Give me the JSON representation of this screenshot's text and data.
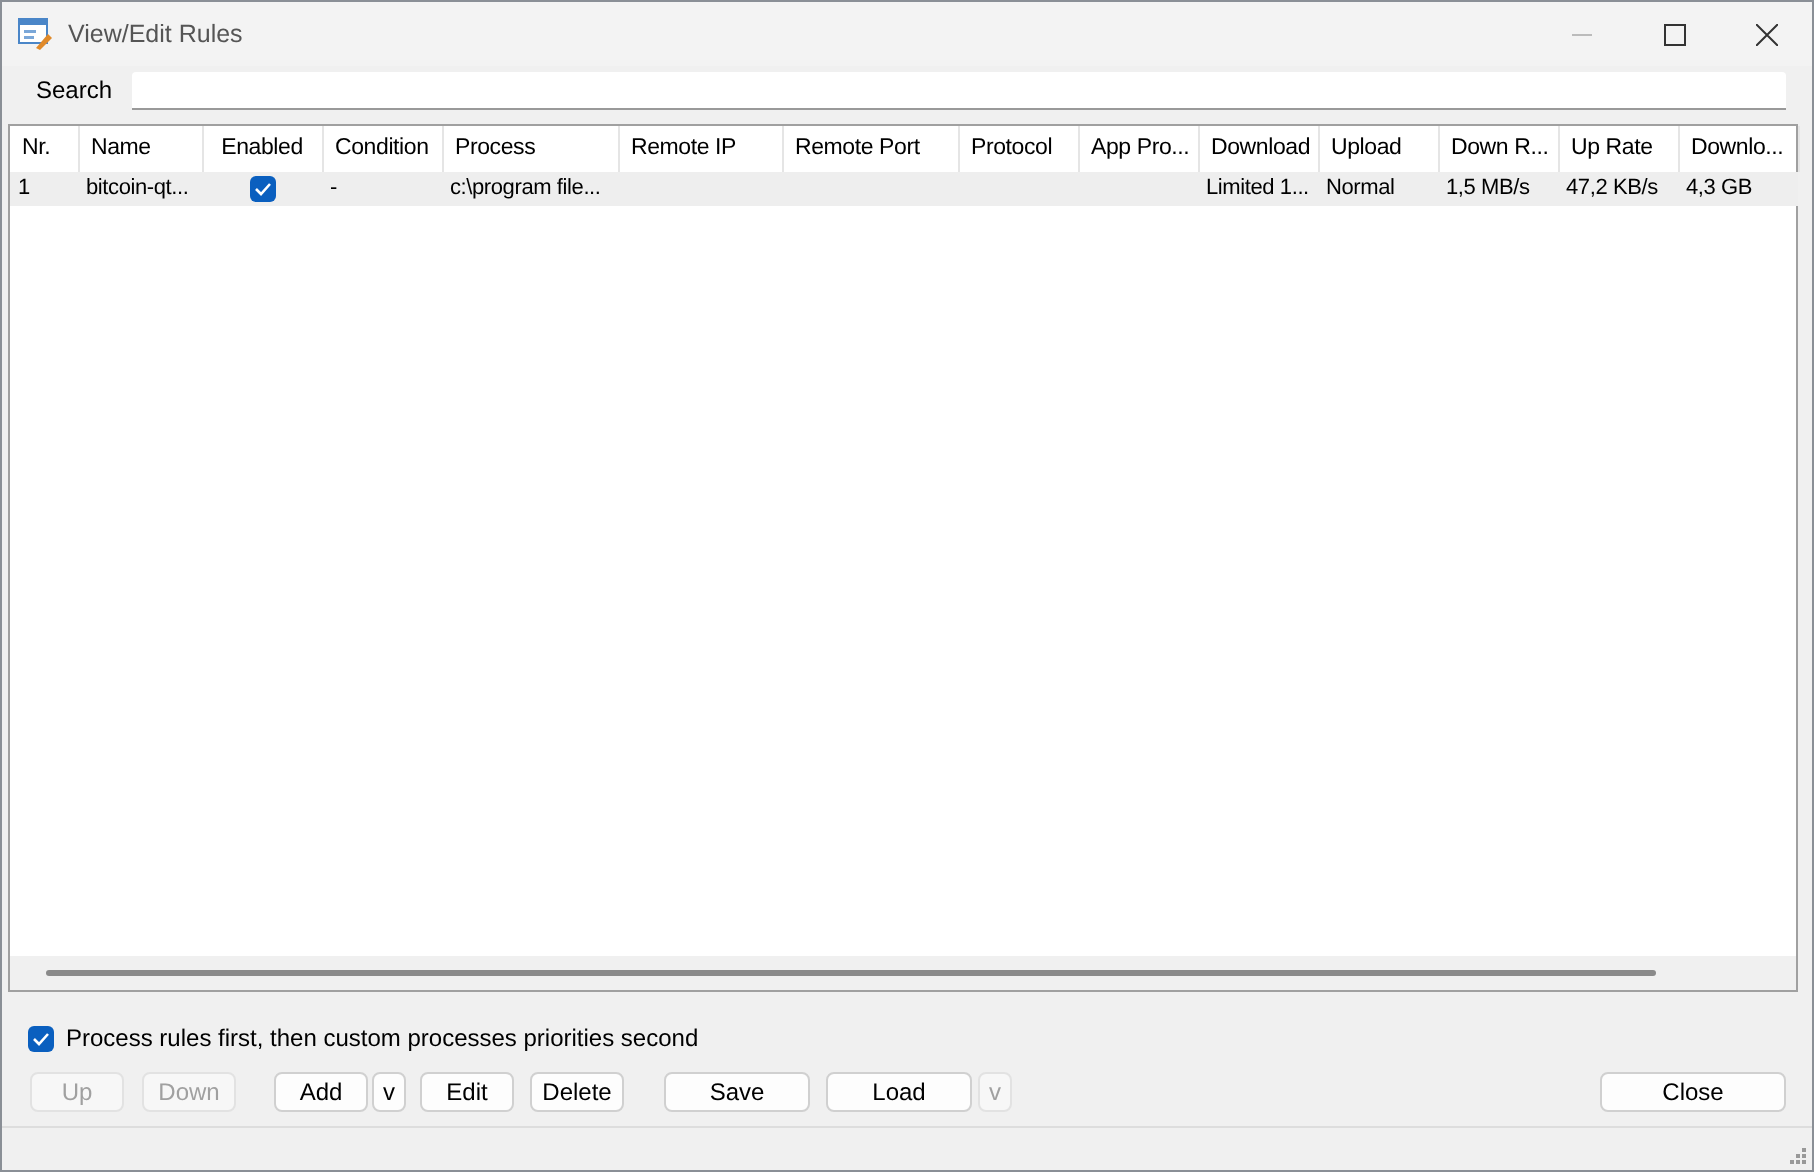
{
  "window": {
    "title": "View/Edit Rules"
  },
  "search": {
    "label": "Search"
  },
  "table": {
    "columns": [
      "Nr.",
      "Name",
      "Enabled",
      "Condition",
      "Process",
      "Remote IP",
      "Remote Port",
      "Protocol",
      "App Pro...",
      "Download",
      "Upload",
      "Down R...",
      "Up Rate",
      "Downlo..."
    ],
    "rows": [
      {
        "selected": true,
        "cells": [
          "1",
          "bitcoin-qt...",
          null,
          "-",
          "c:\\program file...",
          "",
          "",
          "",
          "",
          "Limited 1...",
          "Normal",
          "1,5 MB/s",
          "47,2 KB/s",
          "4,3 GB"
        ],
        "enabled": true
      }
    ]
  },
  "option": {
    "label": "Process rules first, then custom processes priorities second",
    "checked": true
  },
  "buttons": [
    {
      "label": "Up",
      "disabled": true,
      "kind": "button"
    },
    {
      "label": "Down",
      "disabled": true,
      "kind": "button"
    },
    {
      "label": "Add",
      "disabled": false,
      "kind": "button"
    },
    {
      "label": "v",
      "disabled": false,
      "kind": "dropdown"
    },
    {
      "label": "Edit",
      "disabled": false,
      "kind": "button"
    },
    {
      "label": "Delete",
      "disabled": false,
      "kind": "button"
    },
    {
      "label": "Save",
      "disabled": false,
      "kind": "button"
    },
    {
      "label": "Load",
      "disabled": false,
      "kind": "button"
    },
    {
      "label": "v",
      "disabled": true,
      "kind": "dropdown"
    },
    {
      "label": "Close",
      "disabled": false,
      "kind": "close"
    }
  ]
}
